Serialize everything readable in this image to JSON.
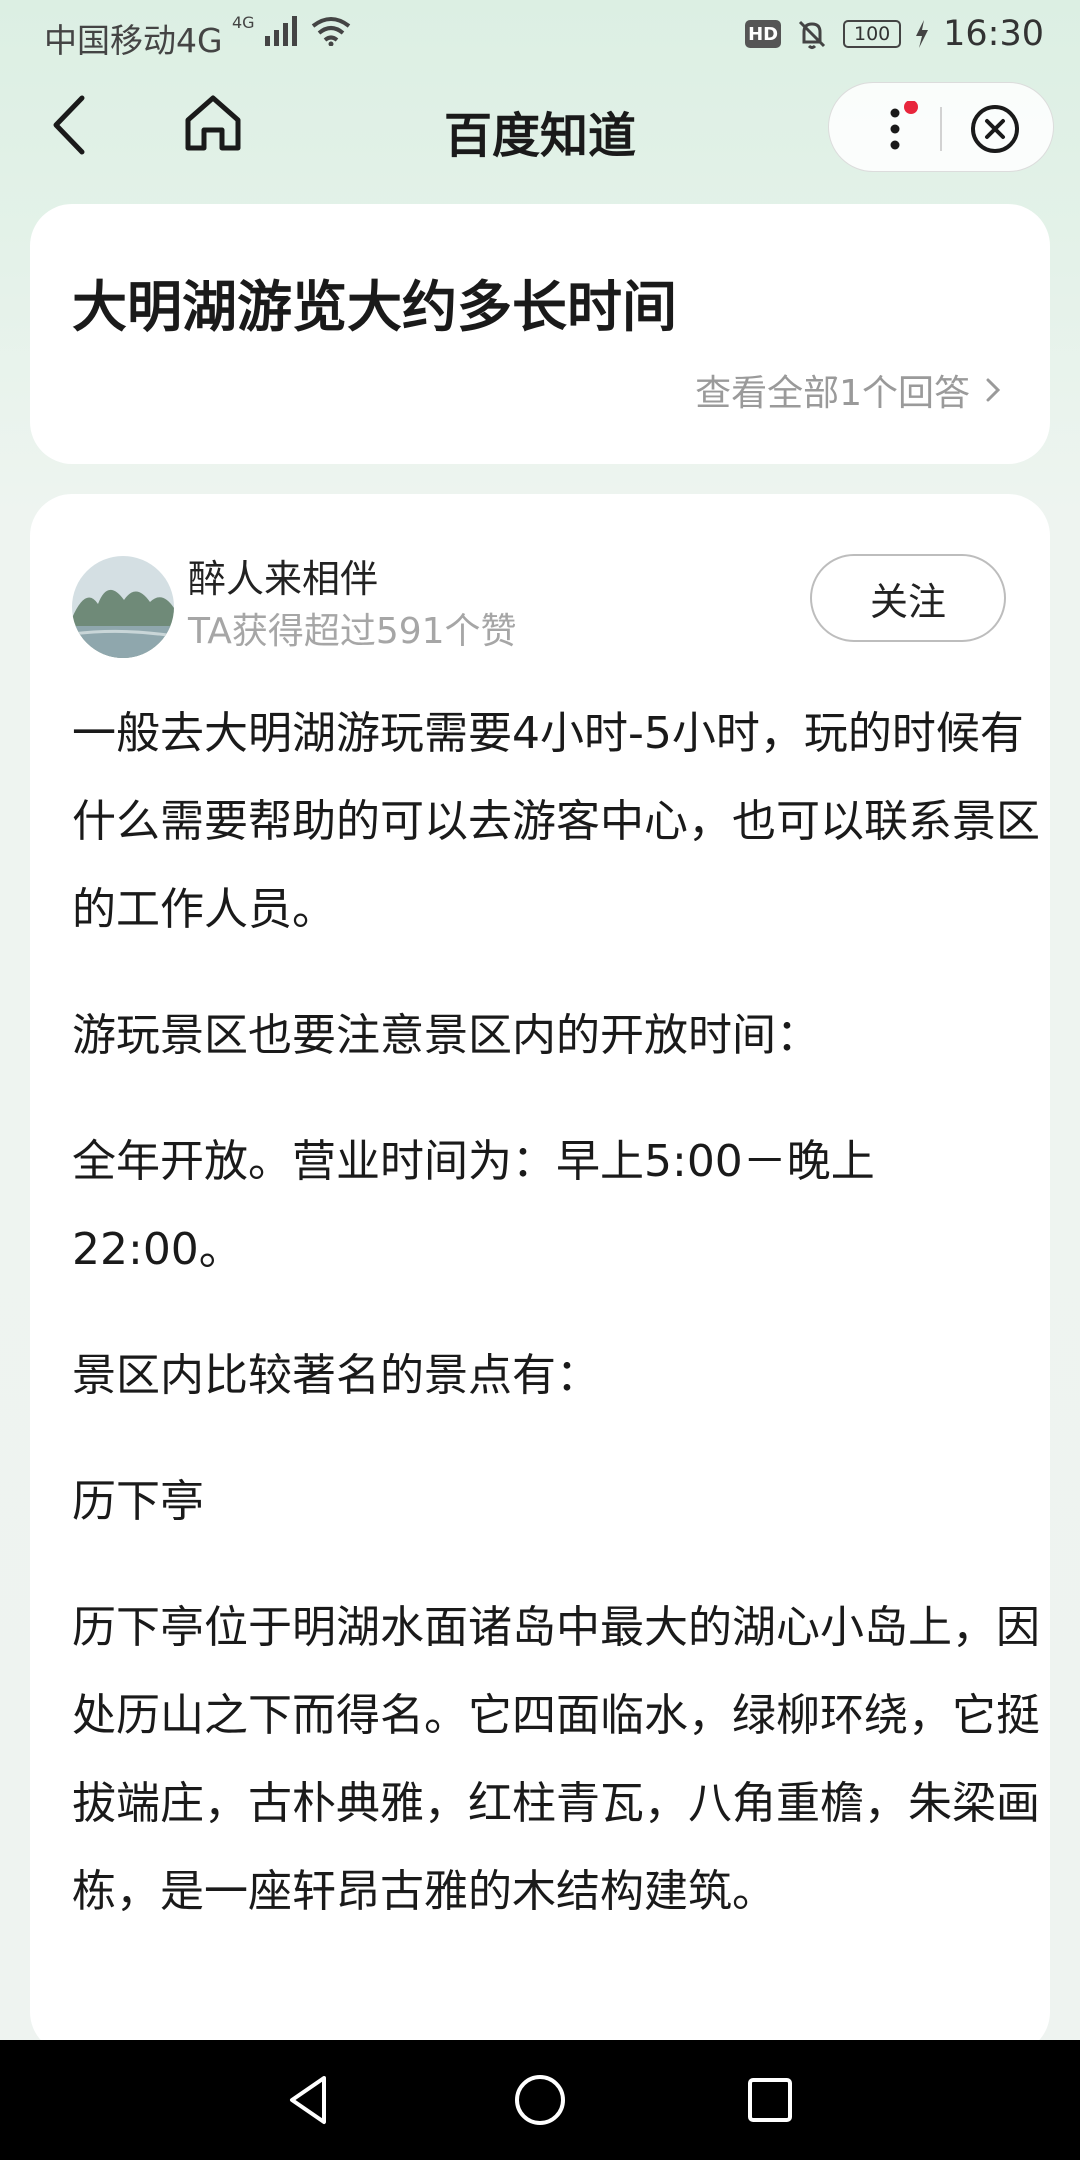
{
  "status_bar": {
    "carrier": "中国移动4G",
    "signal_badge": "4G",
    "hd": "HD",
    "battery": "100",
    "time": "16:30"
  },
  "nav": {
    "title": "百度知道"
  },
  "question": {
    "title": "大明湖游览大约多长时间",
    "view_all": "查看全部1个回答"
  },
  "answer": {
    "author": "醉人来相伴",
    "likes_text": "TA获得超过591个赞",
    "follow_label": "关注",
    "paragraphs": [
      "一般去大明湖游玩需要4小时-5小时，玩的时候有什么需要帮助的可以去游客中心，也可以联系景区的工作人员。",
      "游玩景区也要注意景区内的开放时间：",
      "全年开放。营业时间为：早上5:00－晚上22:00。",
      "景区内比较著名的景点有：",
      "历下亭",
      "历下亭位于明湖水面诸岛中最大的湖心小岛上，因处历山之下而得名。它四面临水，绿柳环绕，它挺拔端庄，古朴典雅，红柱青瓦，八角重檐，朱梁画栋，是一座轩昂古雅的木结构建筑。"
    ]
  },
  "colors": {
    "header_green": "#dcefe3",
    "notification_dot": "#e8263c",
    "navbar": "#000000"
  }
}
